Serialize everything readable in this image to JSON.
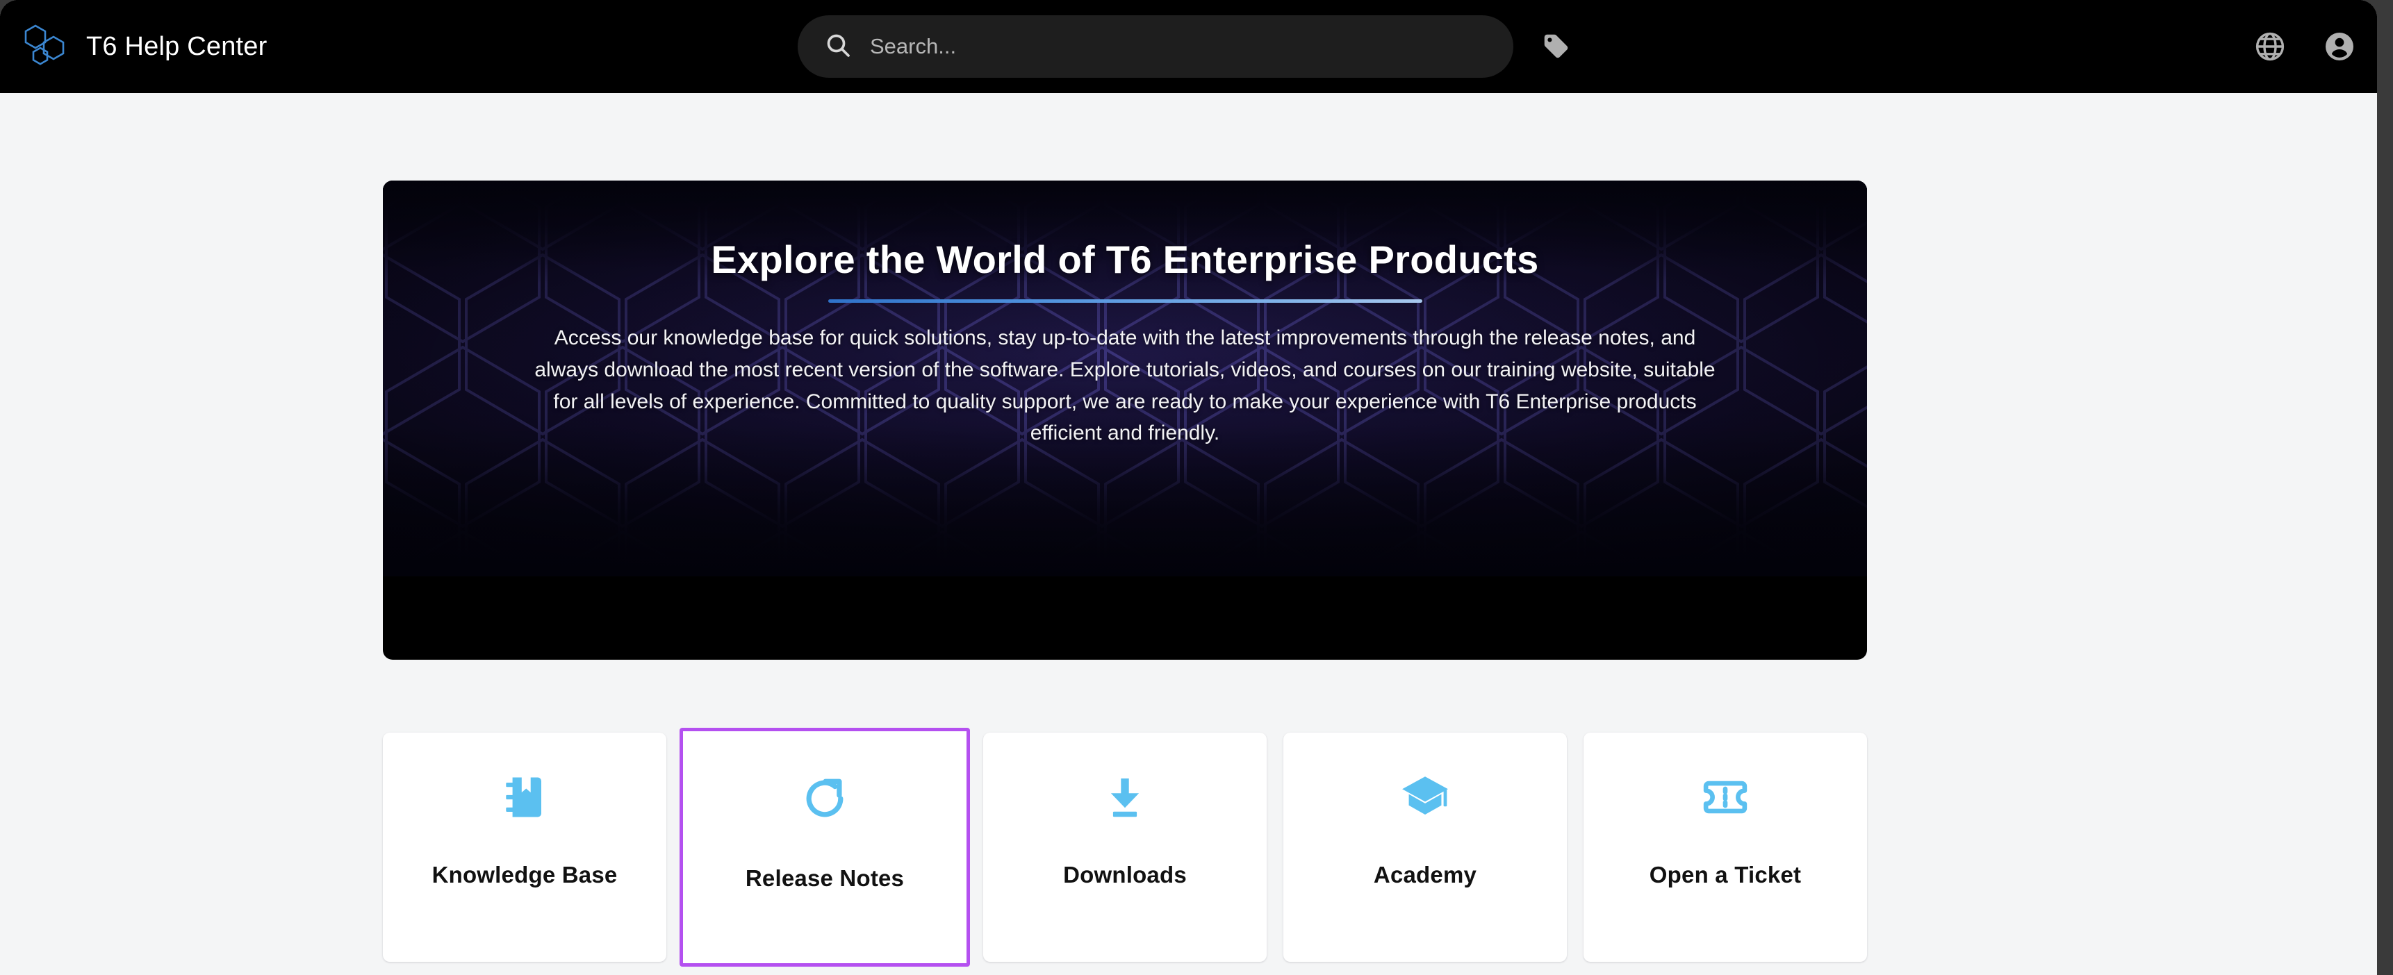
{
  "header": {
    "brand_title": "T6 Help Center",
    "logo_icon": "hexagon-cluster-logo-icon",
    "search": {
      "placeholder": "Search...",
      "value": "",
      "icon": "search-icon"
    },
    "tag_button_icon": "tag-icon",
    "language_button_icon": "globe-icon",
    "account_button_icon": "account-circle-icon"
  },
  "hero": {
    "title": "Explore the World of T6 Enterprise Products",
    "description": "Access our knowledge base for quick solutions, stay up-to-date with the latest improvements through the release notes, and always download the most recent version of the software. Explore tutorials, videos, and courses on our training website, suitable for all levels of experience. Committed to quality support, we are ready to make your experience with T6 Enterprise products efficient and friendly.",
    "background": "hexagon-honeycomb-pattern"
  },
  "cards": [
    {
      "label": "Knowledge Base",
      "icon": "notebook-bookmark-icon",
      "selected": false
    },
    {
      "label": "Release Notes",
      "icon": "refresh-circular-arrow-icon",
      "selected": true
    },
    {
      "label": "Downloads",
      "icon": "download-arrow-icon",
      "selected": false
    },
    {
      "label": "Academy",
      "icon": "graduation-cap-icon",
      "selected": false
    },
    {
      "label": "Open a Ticket",
      "icon": "ticket-icon",
      "selected": false
    }
  ],
  "colors": {
    "header_background": "#000000",
    "page_background": "#f4f5f6",
    "brand_blue": "#3b86d0",
    "icon_blue": "#5bc0f0",
    "selection_purple": "#b450f0",
    "hero_rule_gradient_start": "#2f72c9",
    "hero_rule_gradient_end": "#a8c8ee"
  }
}
